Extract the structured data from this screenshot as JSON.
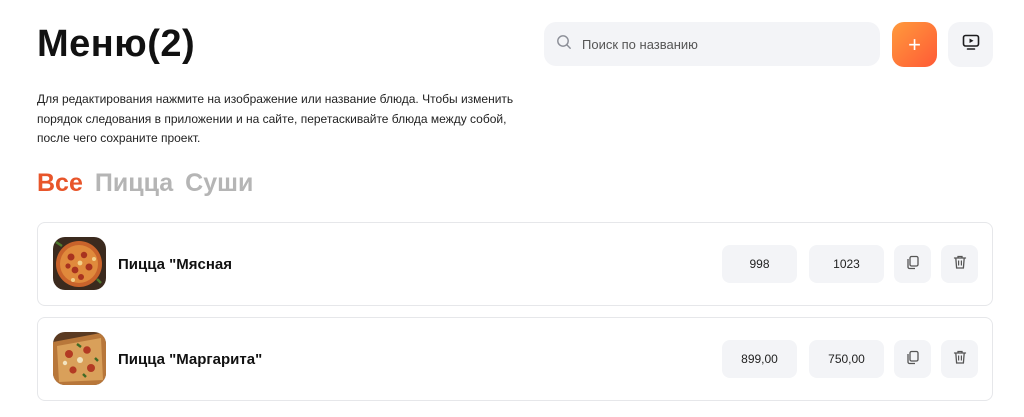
{
  "header": {
    "title": "Меню(2)",
    "search_placeholder": "Поиск по названию",
    "add_label": "+"
  },
  "description": "Для редактирования нажмите на изображение или название блюда. Чтобы изменить порядок следования в приложении и на сайте, перетаскивайте блюда между собой, после чего сохраните проект.",
  "tabs": [
    {
      "label": "Все",
      "active": true
    },
    {
      "label": "Пицца",
      "active": false
    },
    {
      "label": "Суши",
      "active": false
    }
  ],
  "dishes": [
    {
      "name": "Пицца \"Мясная",
      "price": "998",
      "old_price": "1023"
    },
    {
      "name": "Пицца \"Маргарита\"",
      "price": "899,00",
      "old_price": "750,00"
    }
  ],
  "colors": {
    "accent": "#e8552a",
    "add_gradient_start": "#ff9a3c",
    "add_gradient_end": "#ff5a36",
    "field_bg": "#f3f4f7",
    "tab_inactive": "#b5b5b5"
  },
  "icons": [
    "search-icon",
    "plus-icon",
    "monitor-play-icon",
    "copy-icon",
    "trash-icon"
  ]
}
